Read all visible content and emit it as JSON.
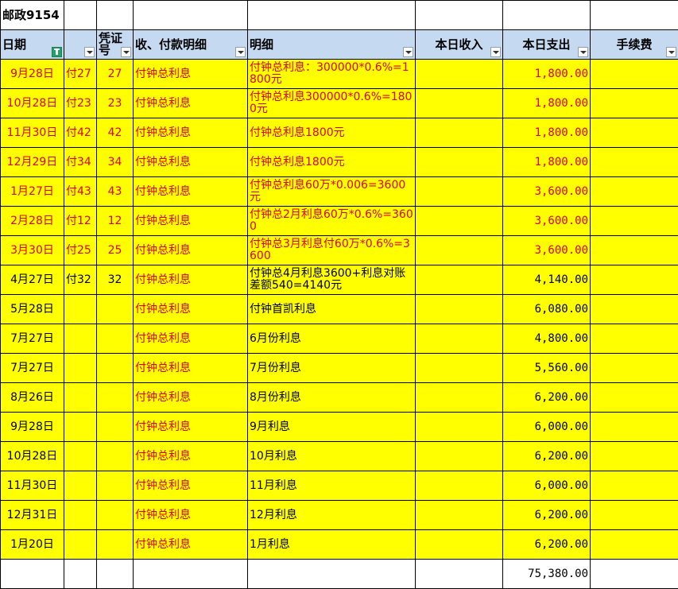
{
  "sheet_title": "邮政9154",
  "headers": [
    "日期",
    "",
    "凭证号",
    "收、付款明细",
    "明细",
    "本日收入",
    "本日支出",
    "手续费"
  ],
  "rows": [
    {
      "date": "9月28日",
      "voucher": "付27",
      "num": "27",
      "item": "付钟总利息",
      "detail": "付钟总利息：300000*0.6%=1800元",
      "income": "",
      "expense": "1,800.00",
      "fee": "",
      "red": true
    },
    {
      "date": "10月28日",
      "voucher": "付23",
      "num": "23",
      "item": "付钟总利息",
      "detail": "付钟总利息300000*0.6%=1800元",
      "income": "",
      "expense": "1,800.00",
      "fee": "",
      "red": true
    },
    {
      "date": "11月30日",
      "voucher": "付42",
      "num": "42",
      "item": "付钟总利息",
      "detail": "付钟总利息1800元",
      "income": "",
      "expense": "1,800.00",
      "fee": "",
      "red": true
    },
    {
      "date": "12月29日",
      "voucher": "付34",
      "num": "34",
      "item": "付钟总利息",
      "detail": "付钟总利息1800元",
      "income": "",
      "expense": "1,800.00",
      "fee": "",
      "red": true
    },
    {
      "date": "1月27日",
      "voucher": "付43",
      "num": "43",
      "item": "付钟总利息",
      "detail": "付钟总利息60万*0.006=3600元",
      "income": "",
      "expense": "3,600.00",
      "fee": "",
      "red": true
    },
    {
      "date": "2月28日",
      "voucher": "付12",
      "num": "12",
      "item": "付钟总利息",
      "detail": "付钟总2月利息60万*0.6%=3600",
      "income": "",
      "expense": "3,600.00",
      "fee": "",
      "red": true
    },
    {
      "date": "3月30日",
      "voucher": "付25",
      "num": "25",
      "item": "付钟总利息",
      "detail": "付钟总3月利息付60万*0.6%=3600",
      "income": "",
      "expense": "3,600.00",
      "fee": "",
      "red": true
    },
    {
      "date": "4月27日",
      "voucher": "付32",
      "num": "32",
      "item": "付钟总利息",
      "detail": "付钟总4月利息3600+利息对账差额540=4140元",
      "income": "",
      "expense": "4,140.00",
      "fee": "",
      "red": false
    },
    {
      "date": "5月28日",
      "voucher": "",
      "num": "",
      "item": "付钟总利息",
      "detail": "付钟首凯利息",
      "income": "",
      "expense": "6,080.00",
      "fee": "",
      "red": false
    },
    {
      "date": "7月27日",
      "voucher": "",
      "num": "",
      "item": "付钟总利息",
      "detail": "6月份利息",
      "income": "",
      "expense": "4,800.00",
      "fee": "",
      "red": false
    },
    {
      "date": "7月27日",
      "voucher": "",
      "num": "",
      "item": "付钟总利息",
      "detail": "7月份利息",
      "income": "",
      "expense": "5,560.00",
      "fee": "",
      "red": false
    },
    {
      "date": "8月26日",
      "voucher": "",
      "num": "",
      "item": "付钟总利息",
      "detail": "8月份利息",
      "income": "",
      "expense": "6,200.00",
      "fee": "",
      "red": false
    },
    {
      "date": "9月28日",
      "voucher": "",
      "num": "",
      "item": "付钟总利息",
      "detail": "9月利息",
      "income": "",
      "expense": "6,000.00",
      "fee": "",
      "red": false
    },
    {
      "date": "10月28日",
      "voucher": "",
      "num": "",
      "item": "付钟总利息",
      "detail": "10月利息",
      "income": "",
      "expense": "6,200.00",
      "fee": "",
      "red": false
    },
    {
      "date": "11月30日",
      "voucher": "",
      "num": "",
      "item": "付钟总利息",
      "detail": "11月利息",
      "income": "",
      "expense": "6,000.00",
      "fee": "",
      "red": false
    },
    {
      "date": "12月31日",
      "voucher": "",
      "num": "",
      "item": "付钟总利息",
      "detail": "12月利息",
      "income": "",
      "expense": "6,200.00",
      "fee": "",
      "red": false
    },
    {
      "date": "1月20日",
      "voucher": "",
      "num": "",
      "item": "付钟总利息",
      "detail": "1月利息",
      "income": "",
      "expense": "6,200.00",
      "fee": "",
      "red": false
    }
  ],
  "total_expense": "75,380.00",
  "colors": {
    "header_bg": "#c5d9f1",
    "row_bg": "#ffff00",
    "red_text": "#e00000",
    "item_text": "#e00000",
    "filter_active": "#21a366"
  },
  "icons": {
    "filter_dropdown": "filter-dropdown-icon",
    "filter_active": "filter-active-icon"
  }
}
